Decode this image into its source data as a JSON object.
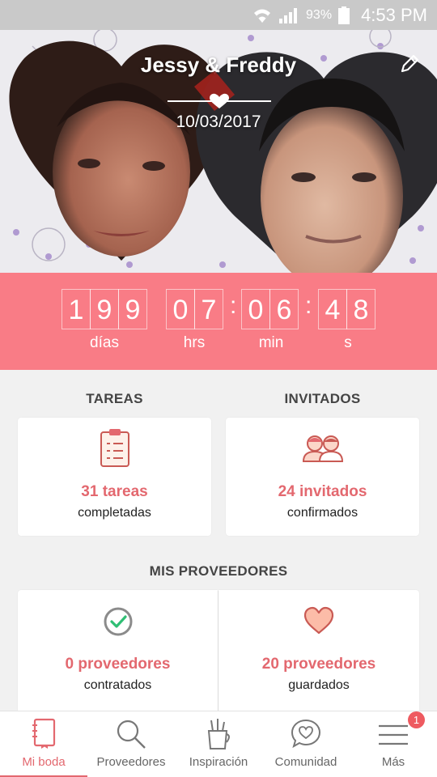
{
  "status_bar": {
    "battery": "93%",
    "time": "4:53 PM"
  },
  "hero": {
    "title": "Jessy & Freddy",
    "date": "10/03/2017"
  },
  "countdown": {
    "days": [
      "1",
      "9",
      "9"
    ],
    "hours": [
      "0",
      "7"
    ],
    "minutes": [
      "0",
      "6"
    ],
    "seconds": [
      "4",
      "8"
    ],
    "labels": {
      "days": "días",
      "hours": "hrs",
      "minutes": "min",
      "seconds": "s"
    }
  },
  "tasks": {
    "title": "TAREAS",
    "count": "31 tareas",
    "sub": "completadas"
  },
  "guests": {
    "title": "INVITADOS",
    "count": "24 invitados",
    "sub": "confirmados"
  },
  "vendors": {
    "title": "MIS PROVEEDORES",
    "hired": {
      "count": "0 proveedores",
      "sub": "contratados"
    },
    "saved": {
      "count": "20 proveedores",
      "sub": "guardados"
    }
  },
  "nav": [
    {
      "label": "Mi boda",
      "icon": "notebook-icon",
      "active": true
    },
    {
      "label": "Proveedores",
      "icon": "search-icon"
    },
    {
      "label": "Inspiración",
      "icon": "pencil-cup-icon"
    },
    {
      "label": "Comunidad",
      "icon": "chat-heart-icon"
    },
    {
      "label": "Más",
      "icon": "menu-icon"
    }
  ],
  "notification_badge": "1",
  "colors": {
    "accent": "#e3686f",
    "countdown_bg": "#f97c86",
    "status_bar": "#c9c9c9"
  }
}
